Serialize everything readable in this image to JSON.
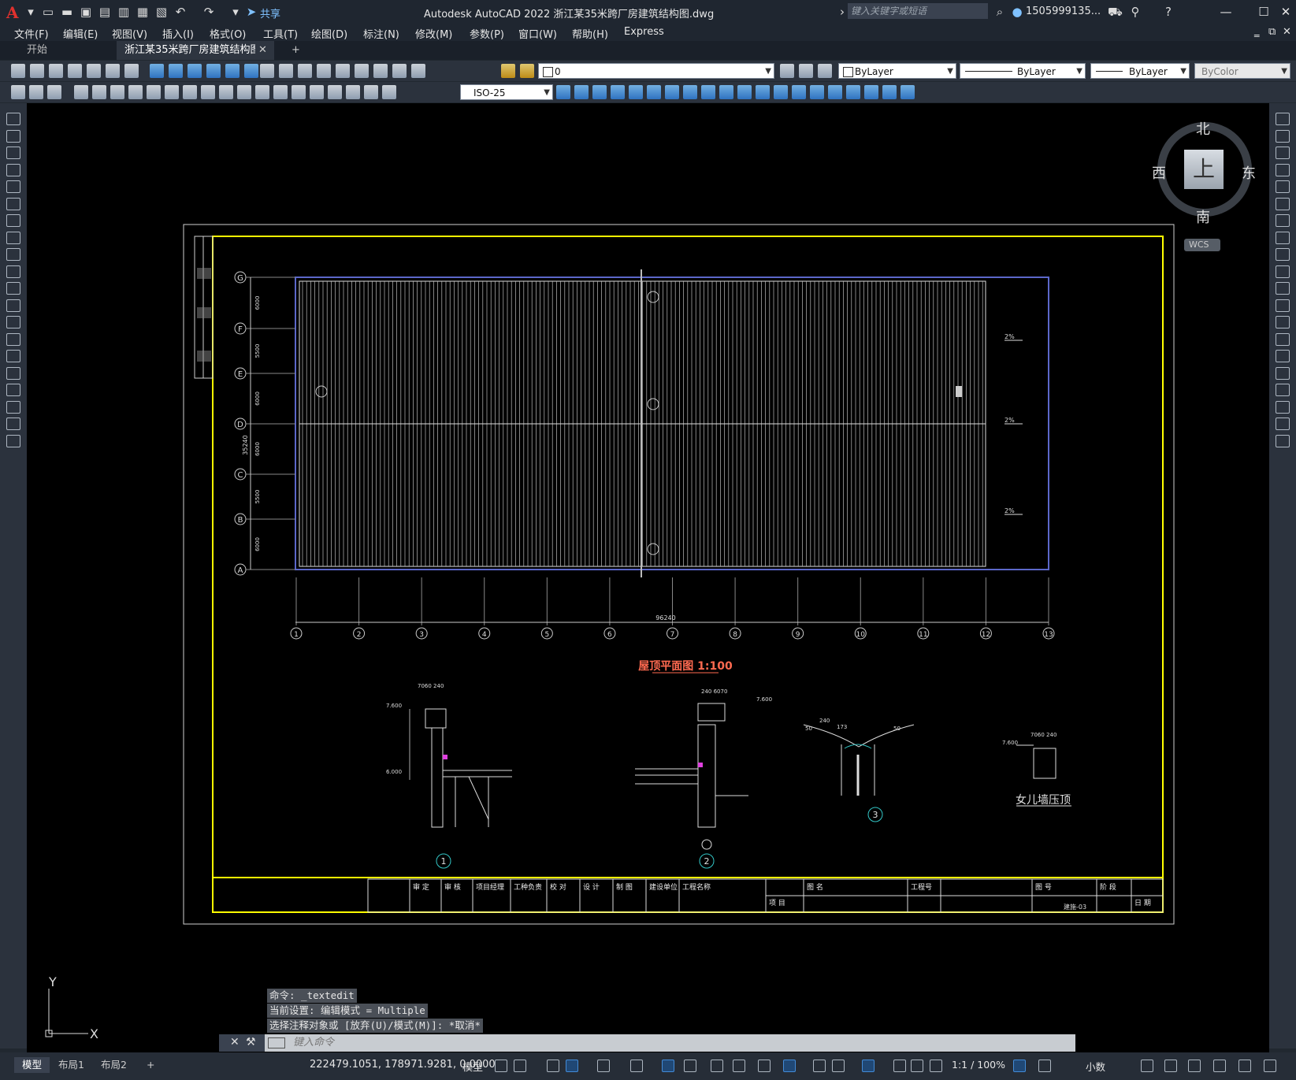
{
  "app": {
    "title": "Autodesk AutoCAD 2022    浙江某35米跨厂房建筑结构图.dwg",
    "logo": "A",
    "share_label": "共享",
    "search_placeholder": "键入关键字或短语",
    "user_name": "1505999135...",
    "icons": [
      "new-icon",
      "open-icon",
      "save-icon",
      "saveas-icon",
      "publish-icon",
      "print-icon",
      "undo-icon",
      "redo-icon",
      "share-icon"
    ]
  },
  "menu": [
    "文件(F)",
    "编辑(E)",
    "视图(V)",
    "插入(I)",
    "格式(O)",
    "工具(T)",
    "绘图(D)",
    "标注(N)",
    "修改(M)",
    "参数(P)",
    "窗口(W)",
    "帮助(H)",
    "Express"
  ],
  "tabs": [
    {
      "label": "开始",
      "active": false
    },
    {
      "label": "浙江某35米跨厂房建筑结构图*",
      "active": true
    }
  ],
  "properties": {
    "layer": "0",
    "color": "ByLayer",
    "linetype": "ByLayer",
    "lineweight": "ByLayer",
    "plotstyle": "ByColor",
    "dimstyle": "ISO-25"
  },
  "viewcube": {
    "north": "北",
    "south": "南",
    "west": "西",
    "east": "东",
    "top": "上",
    "wcs": "WCS"
  },
  "ucs": {
    "x": "X",
    "y": "Y"
  },
  "drawing": {
    "row_labels": [
      "G",
      "F",
      "E",
      "D",
      "C",
      "B",
      "A"
    ],
    "column_labels": [
      "1",
      "2",
      "3",
      "4",
      "5",
      "6",
      "7",
      "8",
      "9",
      "10",
      "11",
      "12",
      "13"
    ],
    "row_dims": [
      "6000",
      "5500",
      "6000",
      "6000",
      "5500",
      "6000"
    ],
    "overall_width": "96240",
    "overall_height": "35240",
    "plan_title": "屋顶平面图 1:100",
    "parapet_title": "女儿墙压顶",
    "right_marks": [
      "2%",
      "2%",
      "2%"
    ],
    "details": [
      "1",
      "2",
      "3"
    ],
    "detail_dims": {
      "d1_top": "7060 240",
      "d1_level": "7.600",
      "d1_level2": "6.000",
      "d2_top": "240 6070",
      "d2_level": "7.600",
      "d3_dims": "240",
      "d3_left": "50",
      "d3_right": "50",
      "d3_mid": "173",
      "d4_top": "7060 240",
      "d4_level": "7.600"
    },
    "titleblock": {
      "cells": [
        "审 定",
        "审 核",
        "项目经理",
        "工种负责",
        "校 对",
        "设 计",
        "制 图",
        "建设单位",
        "工程名称",
        "项 目",
        "图 名",
        "工程号",
        "图 号",
        "阶 段",
        "日 期"
      ],
      "drawing_no": "建施-03"
    }
  },
  "command": {
    "history": [
      "命令: _textedit",
      "当前设置: 编辑模式 = Multiple",
      "选择注释对象或 [放弃(U)/模式(M)]: *取消*"
    ],
    "placeholder": "键入命令"
  },
  "status": {
    "layouts": [
      "模型",
      "布局1",
      "布局2"
    ],
    "coordinates": "222479.1051, 178971.9281, 0.0000",
    "model_label": "模型",
    "scale": "1:1 / 100%",
    "units": "小数"
  }
}
